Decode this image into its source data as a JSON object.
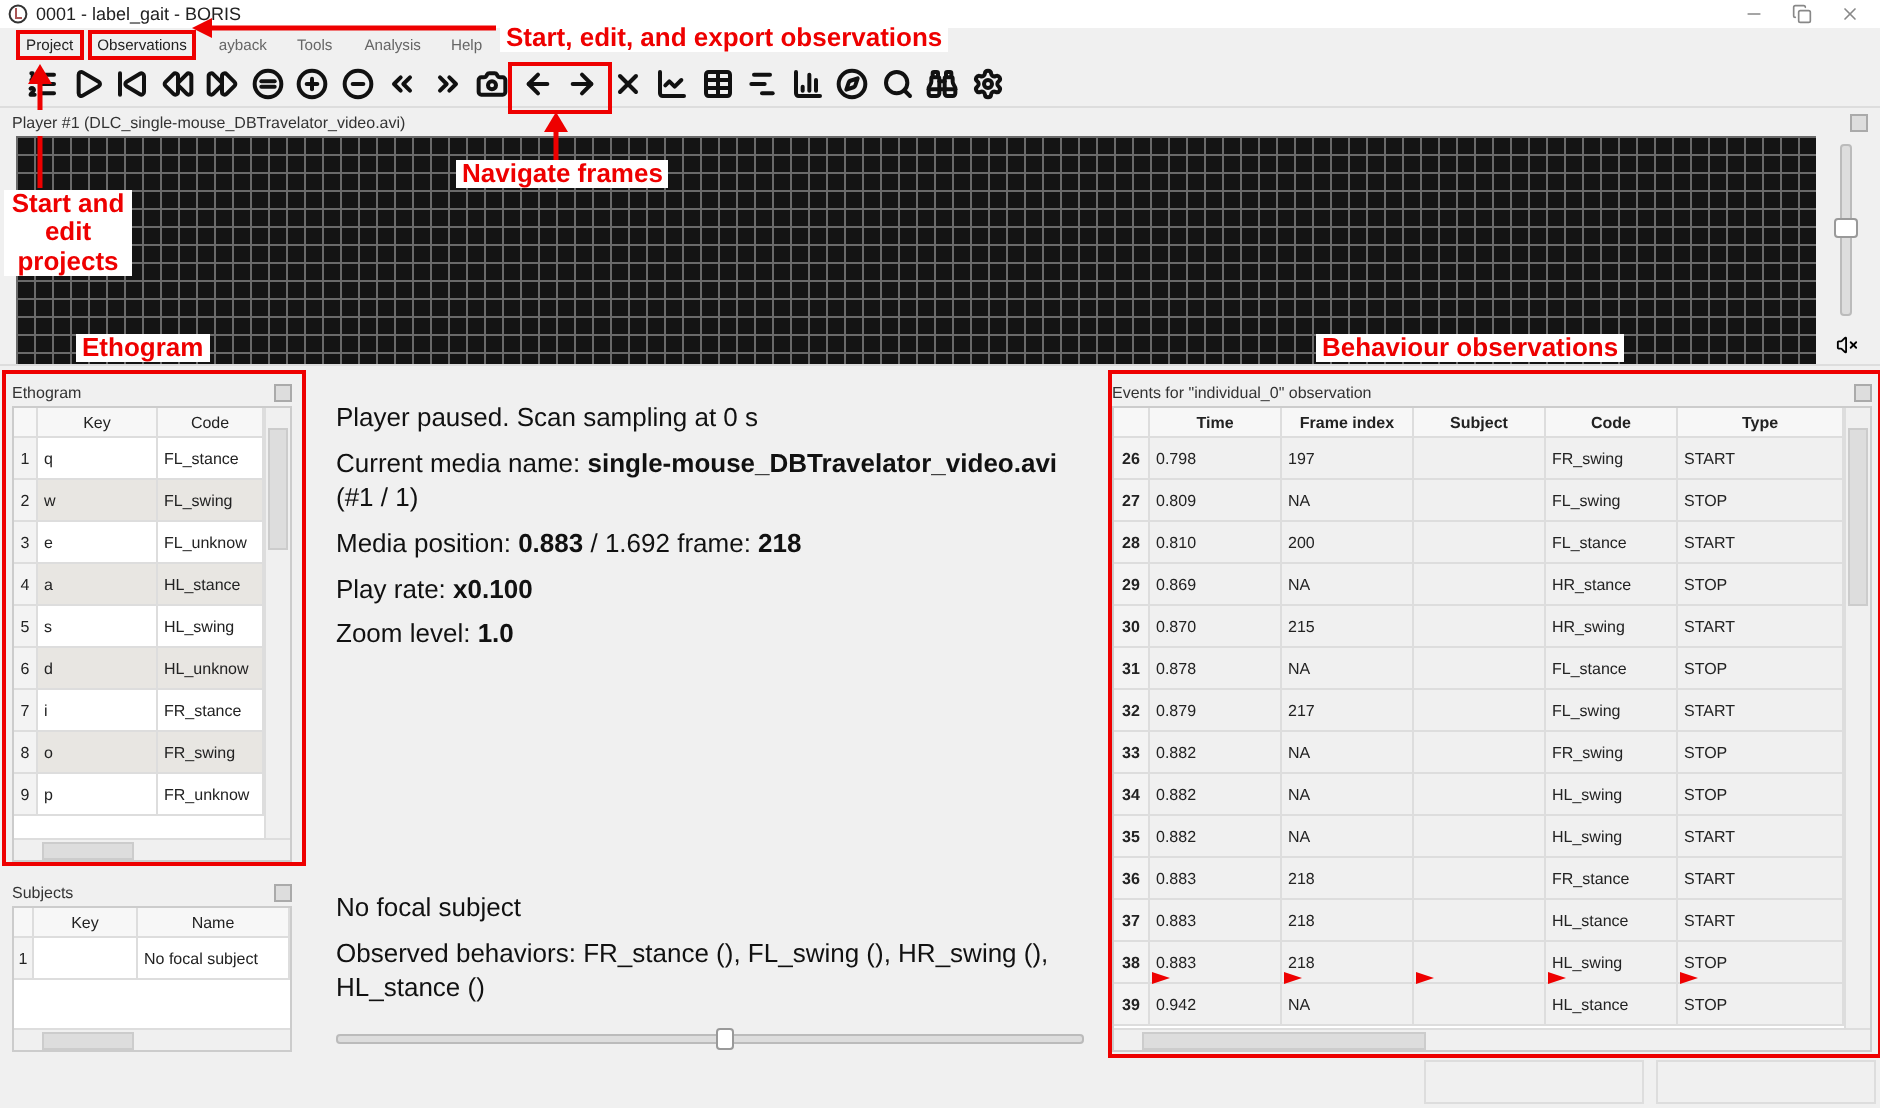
{
  "window": {
    "title": "0001 - label_gait - BORIS"
  },
  "menu": [
    {
      "label": "Project",
      "highlighted": true
    },
    {
      "label": "Observations",
      "highlighted": true
    },
    {
      "label": "ayback",
      "highlighted": false
    },
    {
      "label": "Tools",
      "highlighted": false
    },
    {
      "label": "Analysis",
      "highlighted": false
    },
    {
      "label": "Help",
      "highlighted": false
    }
  ],
  "player": {
    "title": "Player #1 (DLC_single-mouse_DBTravelator_video.avi)",
    "volume": {
      "level": 0.5
    }
  },
  "ethogram": {
    "title": "Ethogram",
    "columns": [
      "Key",
      "Code"
    ],
    "rows": [
      {
        "index": "1",
        "key": "q",
        "code": "FL_stance"
      },
      {
        "index": "2",
        "key": "w",
        "code": "FL_swing"
      },
      {
        "index": "3",
        "key": "e",
        "code": "FL_unknow"
      },
      {
        "index": "4",
        "key": "a",
        "code": "HL_stance"
      },
      {
        "index": "5",
        "key": "s",
        "code": "HL_swing"
      },
      {
        "index": "6",
        "key": "d",
        "code": "HL_unknow"
      },
      {
        "index": "7",
        "key": "i",
        "code": "FR_stance"
      },
      {
        "index": "8",
        "key": "o",
        "code": "FR_swing"
      },
      {
        "index": "9",
        "key": "p",
        "code": "FR_unknow"
      }
    ]
  },
  "subjects": {
    "title": "Subjects",
    "columns": [
      "Key",
      "Name"
    ],
    "rows": [
      {
        "index": "1",
        "name": "No focal subject"
      }
    ]
  },
  "info": {
    "lines": [
      "Player paused. Scan sampling at 0 s",
      "Current media name: **single-mouse_DBTravelator_video.avi** (#1 / 1)",
      "Media position: **0.883** / 1.692 frame: **218**",
      "Play rate: **x0.100**",
      "Zoom level: **1.0**"
    ],
    "focal": "No focal subject",
    "observed": "Observed behaviors: FR_stance (), FL_swing (), HR_swing (), HL_stance ()",
    "position": {
      "level": 0.52
    }
  },
  "events": {
    "title": "Events for \"individual_0\" observation",
    "columns": [
      "Time",
      "Frame index",
      "Subject",
      "Code",
      "Type"
    ],
    "rows": [
      {
        "index": "26",
        "time": "0.798",
        "frame": "197",
        "code": "FR_swing",
        "type": "START",
        "current": false
      },
      {
        "index": "27",
        "time": "0.809",
        "frame": "NA",
        "code": "FL_swing",
        "type": "STOP",
        "current": false
      },
      {
        "index": "28",
        "time": "0.810",
        "frame": "200",
        "code": "FL_stance",
        "type": "START",
        "current": false
      },
      {
        "index": "29",
        "time": "0.869",
        "frame": "NA",
        "code": "HR_stance",
        "type": "STOP",
        "current": false
      },
      {
        "index": "30",
        "time": "0.870",
        "frame": "215",
        "code": "HR_swing",
        "type": "START",
        "current": false
      },
      {
        "index": "31",
        "time": "0.878",
        "frame": "NA",
        "code": "FL_stance",
        "type": "STOP",
        "current": false
      },
      {
        "index": "32",
        "time": "0.879",
        "frame": "217",
        "code": "FL_swing",
        "type": "START",
        "current": false
      },
      {
        "index": "33",
        "time": "0.882",
        "frame": "NA",
        "code": "FR_swing",
        "type": "STOP",
        "current": false
      },
      {
        "index": "34",
        "time": "0.882",
        "frame": "NA",
        "code": "HL_swing",
        "type": "STOP",
        "current": false
      },
      {
        "index": "35",
        "time": "0.882",
        "frame": "NA",
        "code": "HL_swing",
        "type": "START",
        "current": false
      },
      {
        "index": "36",
        "time": "0.883",
        "frame": "218",
        "code": "FR_stance",
        "type": "START",
        "current": false
      },
      {
        "index": "37",
        "time": "0.883",
        "frame": "218",
        "code": "HL_stance",
        "type": "START",
        "current": false
      },
      {
        "index": "38",
        "time": "0.883",
        "frame": "218",
        "code": "HL_swing",
        "type": "STOP",
        "current": true
      },
      {
        "index": "39",
        "time": "0.942",
        "frame": "NA",
        "code": "HL_stance",
        "type": "STOP",
        "current": false
      }
    ]
  },
  "annotations": [
    "Start, edit, and export observations",
    "Start and edit projects",
    "Navigate frames",
    "Ethogram",
    "Behaviour observations"
  ]
}
